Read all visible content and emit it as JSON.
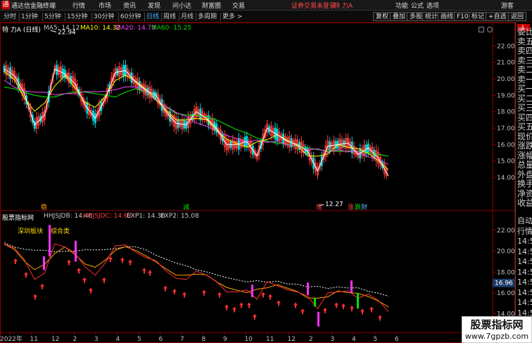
{
  "app": {
    "title": "通达信金融终端",
    "warning": "证券交易未登录",
    "stock_name": "特 力A",
    "guest": "游客"
  },
  "menu": [
    "行情",
    "市场",
    "资讯",
    "发现",
    "问小达",
    "财富圈",
    "交易"
  ],
  "menu_right": [
    "功能",
    "公式",
    "选项"
  ],
  "periods": [
    "分时",
    "1分钟",
    "5分钟",
    "15分钟",
    "30分钟",
    "60分钟",
    "日线",
    "周线",
    "月线",
    "多周期",
    "更多 >"
  ],
  "active_period": "日线",
  "tools": [
    "复权",
    "叠加",
    "多股",
    "统计",
    "画线",
    "F10",
    "标记",
    "+自选",
    "返回"
  ],
  "main_legend": {
    "title": "特 力A (日线)",
    "ma": [
      {
        "label": "MA5: 14.12",
        "color": "#ffffff"
      },
      {
        "label": "MA10: 14.32",
        "color": "#ffff00"
      },
      {
        "label": "MA20: 14.73",
        "color": "#ff40ff"
      },
      {
        "label": "MA60: 15.25",
        "color": "#00e000"
      }
    ]
  },
  "main_axis": {
    "ticks": [
      "22.00",
      "21.00",
      "20.00",
      "19.00",
      "18.00",
      "17.00",
      "16.00",
      "15.00",
      "14.00"
    ],
    "high_label": "22.94",
    "low_label": "12.27"
  },
  "main_events": [
    "稳",
    "减",
    "增",
    "涨",
    "跌",
    "财"
  ],
  "sub_legend": {
    "title": "股票指标网",
    "items": [
      {
        "label": "HHJSJDB: 14.46",
        "color": "#ffffff"
      },
      {
        "label": "HHJSJDC: 14.62",
        "color": "#ff4040"
      },
      {
        "label": "EXP1: 14.30",
        "color": "#ffffff"
      },
      {
        "label": "EXP2: 15.08",
        "color": "#ffffff"
      }
    ],
    "tag1": "深圳板块",
    "tag2": "综合类"
  },
  "sub_axis": {
    "ticks": [
      "22.00",
      "20.00",
      "18.00",
      "16.00",
      "14.00"
    ],
    "current": "16.96"
  },
  "time_axis": [
    "2022年",
    "11",
    "12",
    "2",
    "3",
    "4",
    "5",
    "6",
    "7",
    "8",
    "9",
    "10",
    "11",
    "12",
    "2",
    "3",
    "4",
    "5",
    "6"
  ],
  "right_panel": [
    "委比",
    "卖五",
    "卖四",
    "卖三",
    "卖二",
    "卖一",
    "买一",
    "买二",
    "买三",
    "买四",
    "买五",
    "现价",
    "涨跌",
    "涨幅",
    "总量",
    "外盘",
    "换手",
    "净资",
    "收益",
    "自动",
    "行情",
    "14:5",
    "14:5",
    "14:5",
    "14:5",
    "14:5",
    "14:5",
    "14:5",
    "14:5",
    "14:5",
    "14:5",
    "14:5"
  ],
  "watermark": {
    "line1": "股票指标网",
    "line2": "www.7gpzb.com"
  },
  "chart_data": {
    "type": "line",
    "title": "",
    "series": [
      {
        "name": "MA5",
        "values": [
          20.6,
          20.2,
          19.1,
          17.2,
          17.8,
          20.6,
          20.3,
          19.7,
          18.4,
          17.6,
          18.8,
          20.4,
          20.5,
          19.8,
          19.3,
          19.0,
          18.0,
          17.3,
          17.2,
          18.0,
          17.6,
          17.0,
          16.0,
          16.0,
          16.2,
          15.3,
          17.0,
          16.6,
          16.2,
          16.0,
          15.6,
          14.4,
          15.9,
          16.0,
          16.1,
          15.4,
          15.8,
          15.2,
          14.1
        ]
      },
      {
        "name": "MA60",
        "values": [
          19.5,
          19.4,
          19.2,
          19.0,
          18.9,
          18.9,
          19.1,
          19.2,
          19.2,
          19.1,
          19.0,
          18.9,
          19.2,
          19.4,
          19.2,
          18.7,
          18.3,
          17.9,
          17.8,
          17.8,
          17.7,
          17.5,
          17.2,
          16.9,
          16.7,
          16.4,
          16.2,
          16.1,
          16.0,
          15.9,
          15.8,
          15.7,
          15.6,
          15.6,
          15.6,
          15.6,
          15.5,
          15.4,
          15.3
        ]
      }
    ],
    "ylim": [
      12.2,
      23.0
    ]
  }
}
